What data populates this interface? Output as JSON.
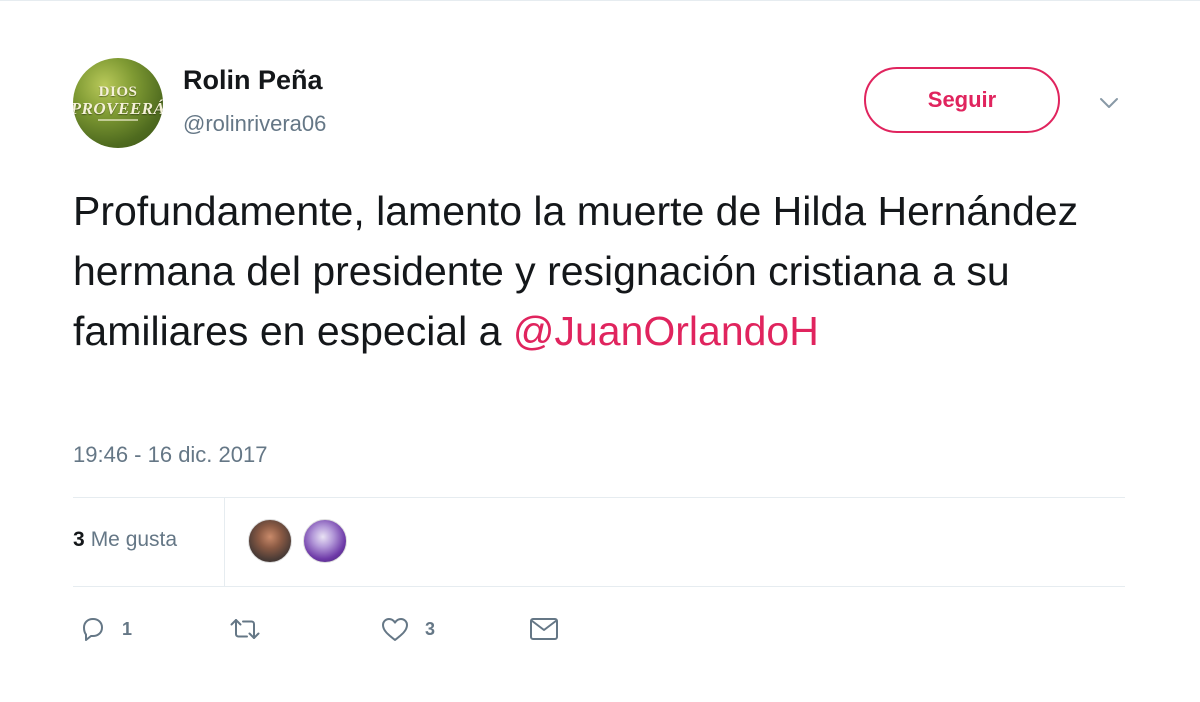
{
  "author": {
    "display_name": "Rolin Peña",
    "handle": "@rolinrivera06",
    "avatar_text": [
      "DIOS",
      "PROVEERÁ"
    ]
  },
  "follow_button": {
    "label": "Seguir"
  },
  "menu": {
    "icon": "chevron-down-icon"
  },
  "tweet": {
    "text": "Profundamente, lamento la muerte de Hilda Hernández hermana del presidente y resignación cristiana a su familiares en especial a ",
    "mention": "@JuanOrlandoH",
    "timestamp": "19:46 - 16 dic. 2017"
  },
  "stats": {
    "likes_count": "3",
    "likes_label": "Me gusta"
  },
  "actions": {
    "reply": {
      "icon": "reply-icon",
      "count": "1"
    },
    "retweet": {
      "icon": "retweet-icon",
      "count": ""
    },
    "like": {
      "icon": "heart-icon",
      "count": "3"
    },
    "dm": {
      "icon": "envelope-icon"
    }
  },
  "colors": {
    "accent": "#e0245e",
    "text": "#14171a",
    "muted": "#657786",
    "divider": "#e6ecf0"
  }
}
